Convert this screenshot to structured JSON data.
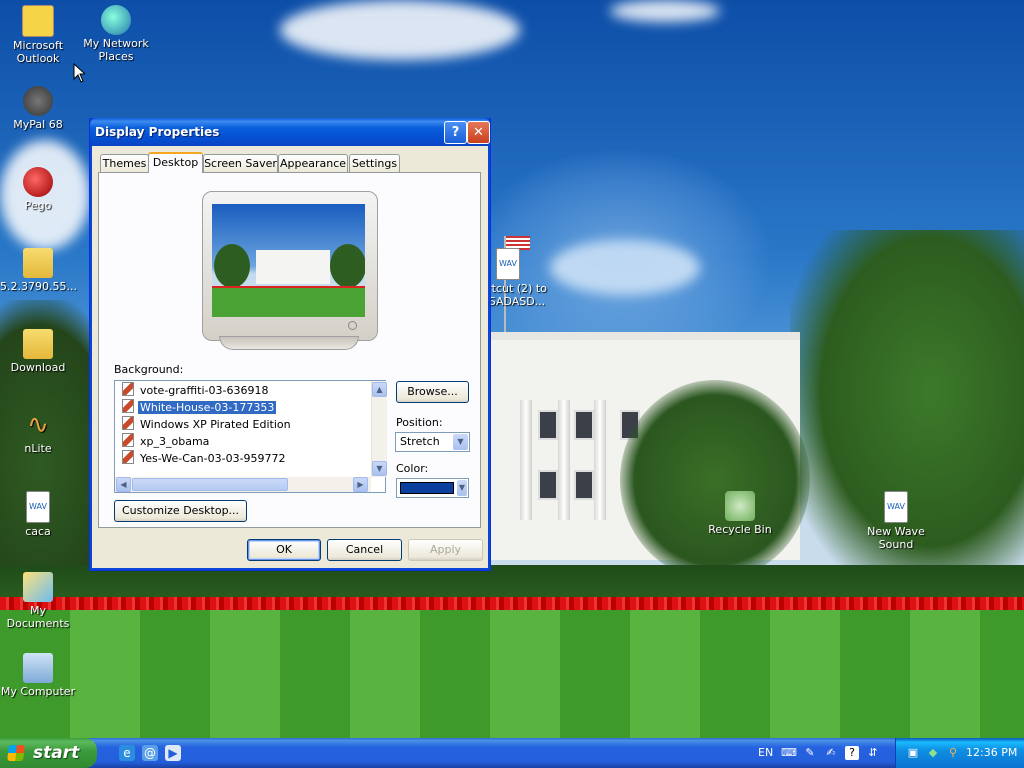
{
  "desktop_icons": [
    {
      "label": "Microsoft Outlook",
      "icon": "outlook-icon"
    },
    {
      "label": "My Network Places",
      "icon": "network-places-icon"
    },
    {
      "label": "MyPal 68",
      "icon": "mypal-icon"
    },
    {
      "label": "Pego",
      "icon": "pego-icon"
    },
    {
      "label": "5.2.3790.55...",
      "icon": "folder-icon"
    },
    {
      "label": "Download",
      "icon": "folder-icon"
    },
    {
      "label": "nLite",
      "icon": "nlite-icon"
    },
    {
      "label": "caca",
      "icon": "wav-file-icon"
    },
    {
      "label": "My Documents",
      "icon": "my-documents-icon"
    },
    {
      "label": "My Computer",
      "icon": "my-computer-icon"
    },
    {
      "label": "rtcut (2) to",
      "icon": "wav-shortcut-icon"
    },
    {
      "label": "SADASD...",
      "icon": "wav-shortcut-icon"
    },
    {
      "label": "Recycle Bin",
      "icon": "recycle-bin-icon"
    },
    {
      "label": "New Wave Sound",
      "icon": "wav-file-icon"
    }
  ],
  "dialog": {
    "title": "Display Properties",
    "help_glyph": "?",
    "close_glyph": "✕",
    "tabs": [
      "Themes",
      "Desktop",
      "Screen Saver",
      "Appearance",
      "Settings"
    ],
    "active_tab": "Desktop",
    "background_label": "Background:",
    "backgrounds": [
      "vote-graffiti-03-636918",
      "White-House-03-177353",
      "Windows XP Pirated Edition",
      "xp_3_obama",
      "Yes-We-Can-03-03-959772"
    ],
    "selected_background": "White-House-03-177353",
    "browse_label": "Browse...",
    "position_label": "Position:",
    "position_value": "Stretch",
    "color_label": "Color:",
    "color_value": "#0a3f9e",
    "customize_label": "Customize Desktop...",
    "ok_label": "OK",
    "cancel_label": "Cancel",
    "apply_label": "Apply"
  },
  "taskbar": {
    "start_label": "start",
    "language": "EN",
    "clock": "12:36 PM"
  }
}
